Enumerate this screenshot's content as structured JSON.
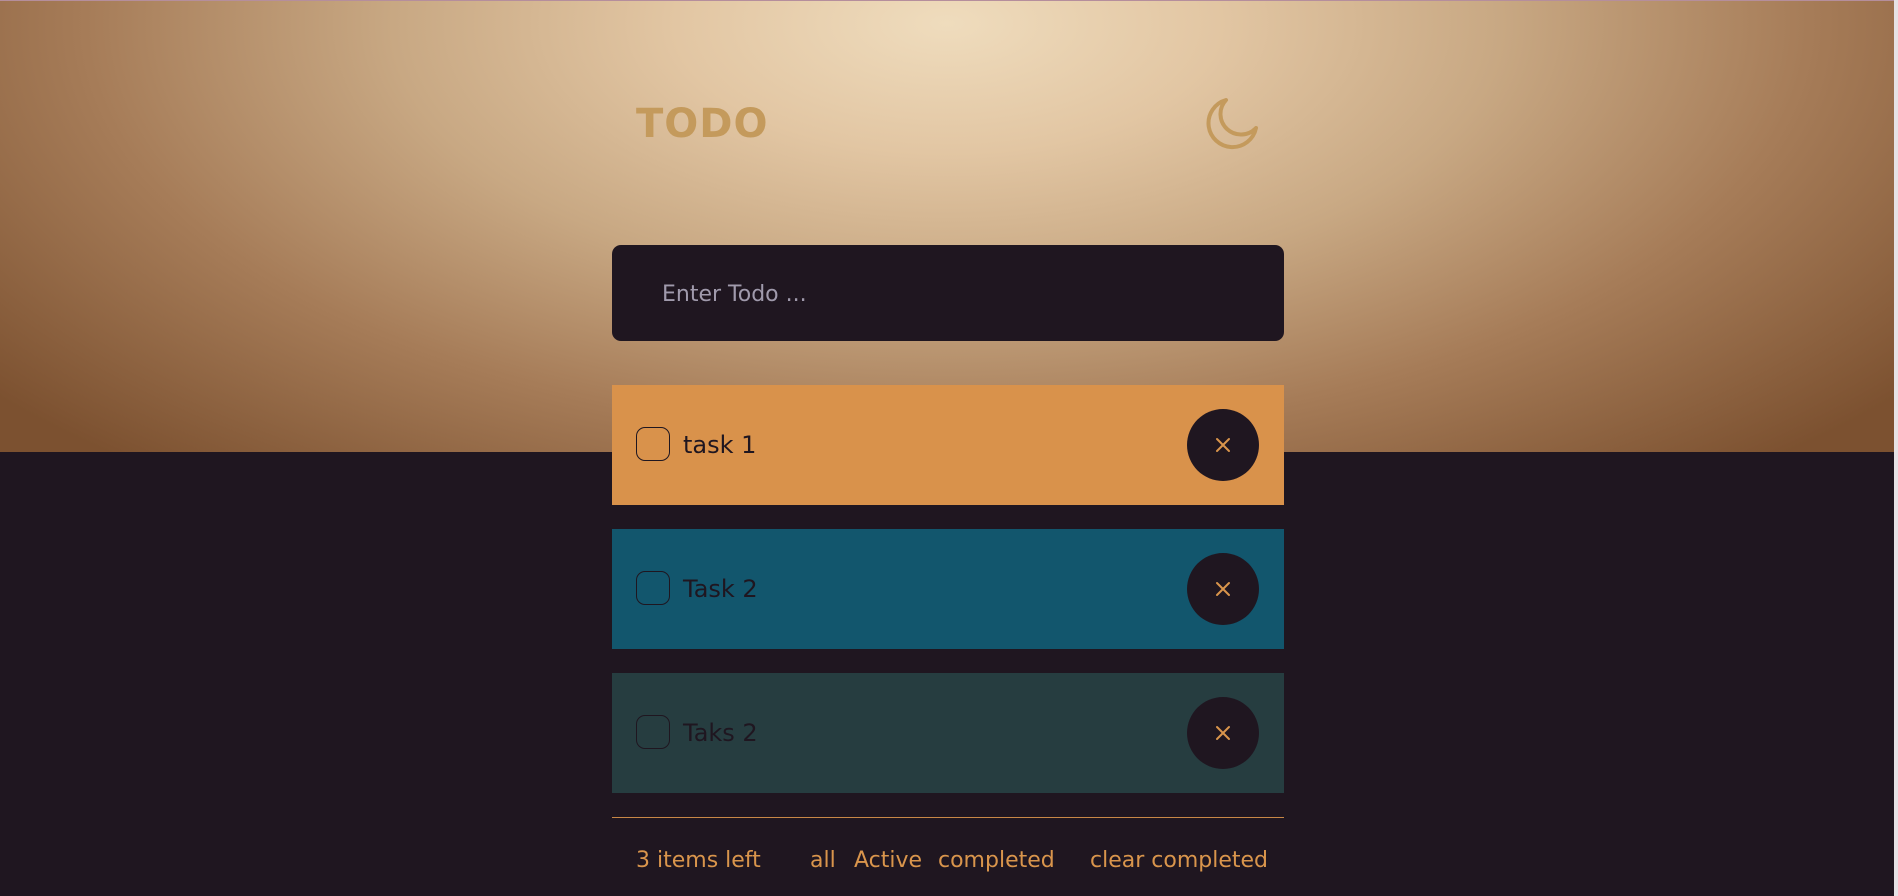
{
  "app": {
    "title": "TODO",
    "theme_toggle_icon": "moon-icon"
  },
  "input": {
    "placeholder": "Enter Todo ...",
    "value": ""
  },
  "todos": [
    {
      "text": "task 1",
      "color": "#d9924b",
      "completed": false
    },
    {
      "text": "Task 2",
      "color": "#12566d",
      "completed": false
    },
    {
      "text": "Taks 2",
      "color": "#263d40",
      "completed": false
    }
  ],
  "footer": {
    "items_left": "3 items left",
    "filter_all": "all",
    "filter_active": "Active",
    "filter_completed": "completed",
    "clear_completed": "clear completed"
  },
  "colors": {
    "background": "#1f1620",
    "accent": "#d9954c",
    "title": "#c49a5c"
  }
}
